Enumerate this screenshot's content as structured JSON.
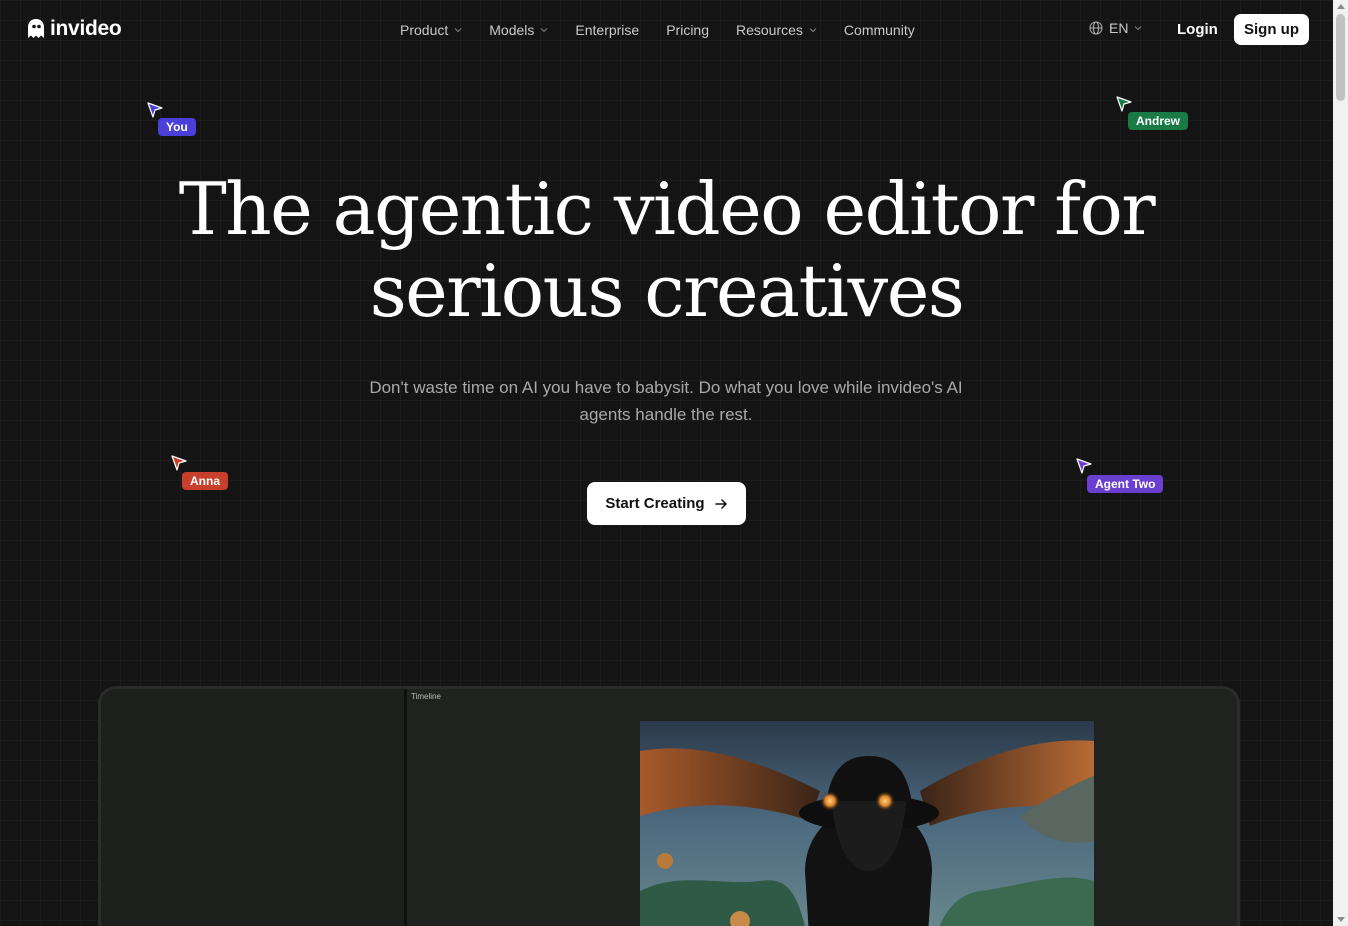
{
  "brand": {
    "name": "invideo"
  },
  "nav": {
    "items": [
      {
        "label": "Product",
        "dropdown": true
      },
      {
        "label": "Models",
        "dropdown": true
      },
      {
        "label": "Enterprise",
        "dropdown": false
      },
      {
        "label": "Pricing",
        "dropdown": false
      },
      {
        "label": "Resources",
        "dropdown": true
      },
      {
        "label": "Community",
        "dropdown": false
      }
    ],
    "language": "EN",
    "login": "Login",
    "signup": "Sign up"
  },
  "cursors": {
    "you": {
      "label": "You",
      "color": "#4a3fd8"
    },
    "andrew": {
      "label": "Andrew",
      "color": "#1a7a45"
    },
    "anna": {
      "label": "Anna",
      "color": "#c8402b"
    },
    "agent_two": {
      "label": "Agent Two",
      "color": "#6a3fd0"
    }
  },
  "hero": {
    "title_line1": "The agentic video editor for",
    "title_line2": "serious creatives",
    "subtitle": "Don't waste time on AI you have to babysit. Do what you love while invideo's AI agents handle the rest.",
    "cta": "Start Creating"
  },
  "editor": {
    "timeline_label": "Timeline"
  },
  "icons": {
    "logo": "ghost-logo-icon",
    "globe": "globe-icon",
    "chevron": "chevron-down-icon",
    "arrow": "arrow-right-icon",
    "cursor": "cursor-arrow-icon"
  }
}
